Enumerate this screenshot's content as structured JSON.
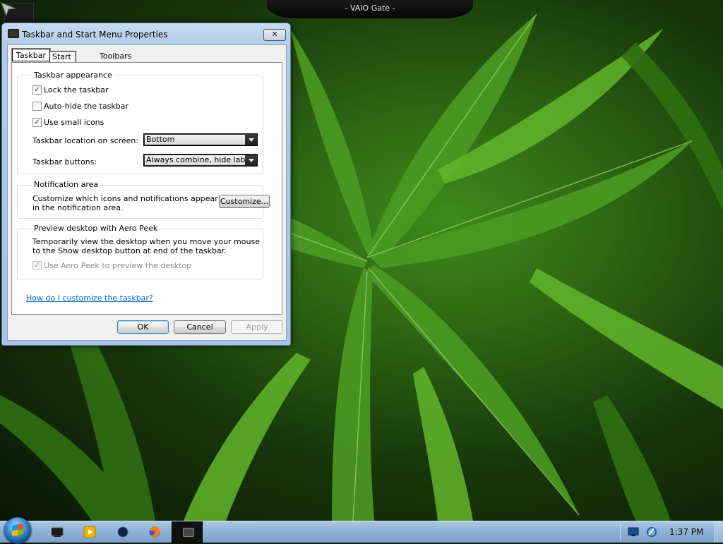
{
  "overlay": {
    "title": "- VAIO Gate -"
  },
  "dialog": {
    "title": "Taskbar and Start Menu Properties",
    "close_glyph": "✕",
    "tabs": [
      {
        "label": "Taskbar",
        "selected": true
      },
      {
        "label": "Start Menu",
        "selected": false
      },
      {
        "label": "Toolbars",
        "selected": false
      }
    ],
    "appearance": {
      "heading": "Taskbar appearance",
      "lock": {
        "label": "Lock the taskbar",
        "checked": true
      },
      "autohide": {
        "label": "Auto-hide the taskbar",
        "checked": false
      },
      "small_icons": {
        "label": "Use small icons",
        "checked": true
      },
      "location_label": "Taskbar location on screen:",
      "location_value": "Bottom",
      "buttons_label": "Taskbar buttons:",
      "buttons_value": "Always combine, hide labels"
    },
    "notification": {
      "heading": "Notification area",
      "text": "Customize which icons and notifications appear in the notification area.",
      "customize_button": "Customize..."
    },
    "aero_peek": {
      "heading": "Preview desktop with Aero Peek",
      "text": "Temporarily view the desktop when you move your mouse to the Show desktop button at end of the taskbar.",
      "checkbox": {
        "label": "Use Aero Peek to preview the desktop",
        "checked": true,
        "disabled": true
      }
    },
    "help_link": "How do I customize the taskbar?",
    "buttons": {
      "ok": "OK",
      "cancel": "Cancel",
      "apply": "Apply"
    }
  },
  "taskbar": {
    "pinned": [
      "terminal-icon",
      "media-player-icon",
      "circle-app-icon",
      "firefox-icon"
    ],
    "active_window": "taskbar-properties-window",
    "tray_icons": [
      "display-icon",
      "network-icon"
    ],
    "clock": "1:37 PM"
  },
  "colors": {
    "link": "#0066cc",
    "taskbar": "#8fb2d6",
    "dialog_frame": "#b4cbe6"
  }
}
